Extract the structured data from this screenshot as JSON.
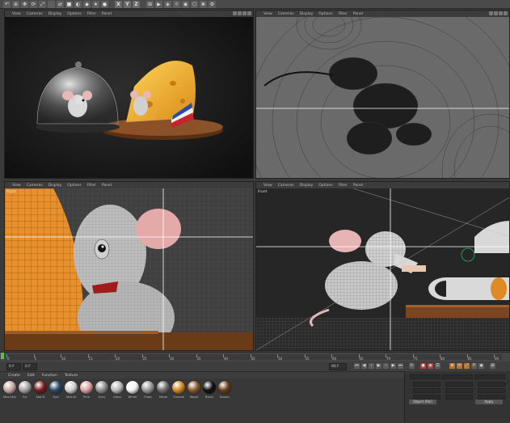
{
  "toolbar": {
    "icons": [
      "↶",
      "⊕",
      "✥",
      "⟳",
      "⤢",
      "",
      "⇄",
      "■",
      "◐",
      "◆",
      "★",
      "●"
    ],
    "axes": [
      "X",
      "Y",
      "Z"
    ],
    "icons2": [
      "⊞",
      "▶",
      "◈",
      "☼",
      "◉",
      "⬡",
      "❀",
      "⚙"
    ]
  },
  "viewports": {
    "perspective": {
      "menu": [
        "View",
        "Cameras",
        "Display",
        "Options",
        "Filter",
        "Panel"
      ]
    },
    "top": {
      "menu": [
        "View",
        "Cameras",
        "Display",
        "Options",
        "Filter",
        "Panel"
      ]
    },
    "right": {
      "menu": [
        "View",
        "Cameras",
        "Display",
        "Options",
        "Filter",
        "Panel"
      ],
      "label": "Right"
    },
    "front": {
      "menu": [
        "View",
        "Cameras",
        "Display",
        "Options",
        "Filter",
        "Panel"
      ],
      "label": "Front"
    }
  },
  "timeline": {
    "ticks": [
      "0",
      "5",
      "10",
      "15",
      "20",
      "25",
      "30",
      "35",
      "40",
      "45",
      "50",
      "55",
      "60",
      "65",
      "70",
      "75",
      "80",
      "85",
      "90"
    ],
    "end_frame": "90 F"
  },
  "transport": {
    "current_frame": "0 F",
    "start_frame": "0 F",
    "end_frame": "90 F"
  },
  "material_manager": {
    "menu": [
      "Create",
      "Edit",
      "Function",
      "Texture"
    ],
    "materials": [
      {
        "name": "Mat.Skin",
        "color": "#c9a9a0"
      },
      {
        "name": "Fur",
        "color": "#a4a4a4"
      },
      {
        "name": "Mat.R",
        "color": "#7a1d1d"
      },
      {
        "name": "Eye",
        "color": "#2b4a6b"
      },
      {
        "name": "Mat.W",
        "color": "#cfcfcf"
      },
      {
        "name": "Pink",
        "color": "#e0a0a0"
      },
      {
        "name": "Grey",
        "color": "#8e8e8e"
      },
      {
        "name": "Glass",
        "color": "#b8b8b8"
      },
      {
        "name": "White",
        "color": "#f4f4f4"
      },
      {
        "name": "Plate",
        "color": "#999999"
      },
      {
        "name": "Metal",
        "color": "#6e6e6e"
      },
      {
        "name": "Cheese",
        "color": "#d58a1e"
      },
      {
        "name": "Wood",
        "color": "#8b5a2b"
      },
      {
        "name": "Black",
        "color": "#101010"
      },
      {
        "name": "Brown",
        "color": "#6b3d1d"
      }
    ]
  },
  "attributes": {
    "button1": "Object (Rel)",
    "button2": "Apply"
  },
  "colors": {
    "cheese": "#e6902a",
    "mouse": "#d8d8d8",
    "wood": "#7a4a22",
    "grid": "#555555",
    "playhead": "#56c25a"
  }
}
